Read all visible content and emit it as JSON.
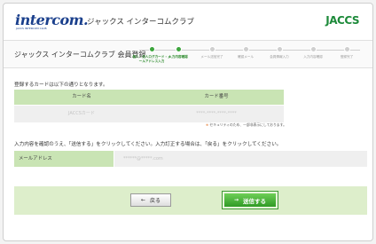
{
  "header": {
    "logo_text": "intercom.",
    "logo_sub": "JACCS INTERCOM CLUB",
    "club_name": "ジャックス インターコムクラブ",
    "brand": "JACCS"
  },
  "titlebar": {
    "page_title": "ジャックス インターコムクラブ 会員登録",
    "steps": [
      {
        "label": "個人・法人ログ力ード・メールアドレス入力",
        "state": "done"
      },
      {
        "label": "入力内容確認",
        "state": "active"
      },
      {
        "label": "メール送信完了",
        "state": "todo"
      },
      {
        "label": "確認メール",
        "state": "todo"
      },
      {
        "label": "会員情報入力",
        "state": "todo"
      },
      {
        "label": "入力内容確認",
        "state": "todo"
      },
      {
        "label": "登録完了",
        "state": "todo"
      }
    ]
  },
  "content": {
    "intro": "登録するカードは以下の通りとなります。",
    "table": {
      "headers": [
        "カード名",
        "カード番号"
      ],
      "row": [
        "JACCSカード",
        "****-****-****-****"
      ]
    },
    "note_mark": "※",
    "note": "セキュリティのため、一部非表示にしております。",
    "instruction": "入力内容を確認のうえ、「送信する」をクリックしてください。入力訂正する場合は、「戻る」をクリックしてください。",
    "mail_label": "メールアドレス",
    "mail_value": "******@*****.com"
  },
  "buttons": {
    "back_arrow": "←",
    "back": "戻る",
    "send_arrow": "→",
    "send": "送信する"
  },
  "colors": {
    "accent_green": "#3da53d",
    "table_header": "#c9e4b4",
    "button_area": "#ddeecb",
    "logo_blue": "#1a3f8c"
  }
}
